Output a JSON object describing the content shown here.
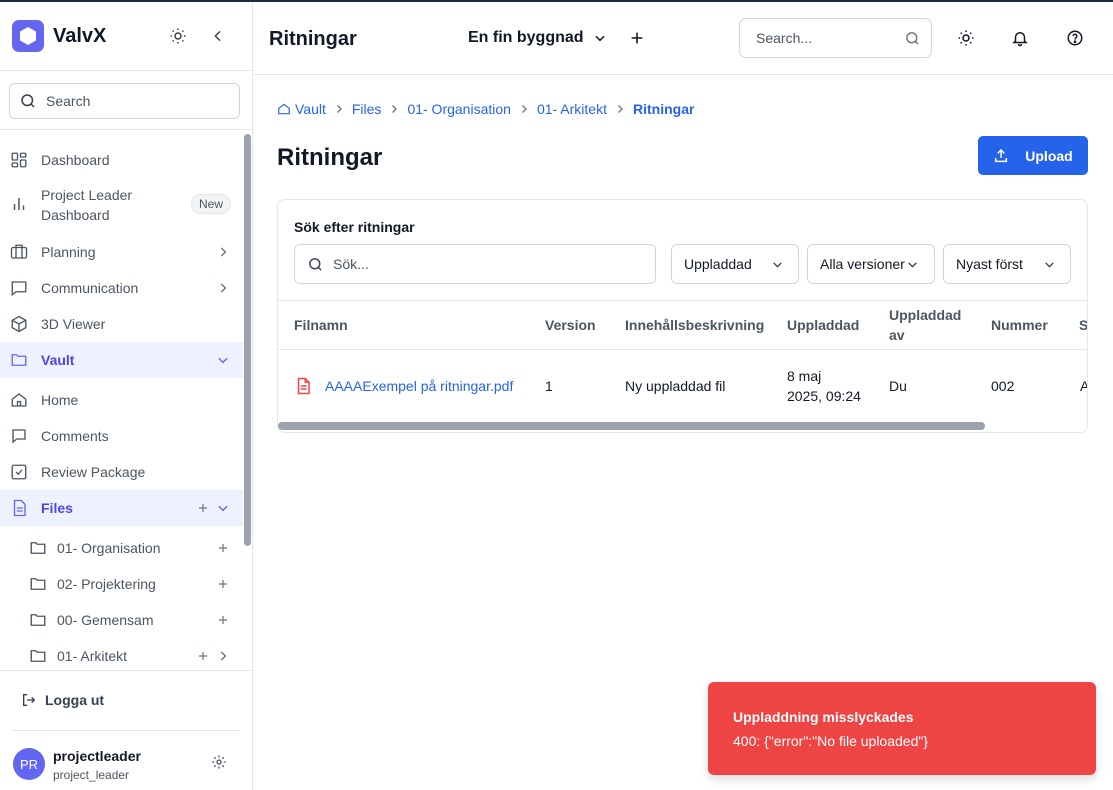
{
  "app": {
    "brand": "ValvX"
  },
  "sidebar": {
    "search_placeholder": "Search",
    "items": [
      {
        "label": "Dashboard",
        "icon": "dashboard-icon"
      },
      {
        "label": "Project Leader Dashboard",
        "label_line1": "Project Leader",
        "label_line2": "Dashboard",
        "badge": "New",
        "icon": "bar-chart-icon"
      },
      {
        "label": "Planning",
        "icon": "planning-icon"
      },
      {
        "label": "Communication",
        "icon": "chat-icon"
      },
      {
        "label": "3D Viewer",
        "icon": "cube-icon"
      },
      {
        "label": "Vault",
        "icon": "folder-icon",
        "active": true
      },
      {
        "label": "Home",
        "icon": "home-icon"
      },
      {
        "label": "Comments",
        "icon": "comment-icon"
      },
      {
        "label": "Review Package",
        "icon": "checkbox-icon"
      },
      {
        "label": "Files",
        "icon": "file-icon",
        "active": true
      }
    ],
    "folders": [
      {
        "label": "01- Organisation"
      },
      {
        "label": "02- Projektering"
      },
      {
        "label": "00- Gemensam"
      },
      {
        "label": "01- Arkitekt"
      }
    ],
    "logout_label": "Logga ut",
    "user": {
      "initials": "PR",
      "name": "projectleader",
      "role": "project_leader"
    }
  },
  "topbar": {
    "title": "Ritningar",
    "project": "En fin byggnad",
    "search_placeholder": "Search..."
  },
  "breadcrumb": [
    "Vault",
    "Files",
    "01- Organisation",
    "01- Arkitekt",
    "Ritningar"
  ],
  "main": {
    "title": "Ritningar",
    "upload_label": "Upload",
    "filter_label": "Sök efter ritningar",
    "filter_placeholder": "Sök...",
    "filters": [
      "Uppladdad",
      "Alla versioner",
      "Nyast först"
    ]
  },
  "table": {
    "columns": [
      "Filnamn",
      "Version",
      "Innehållsbeskrivning",
      "Uppladdad",
      "Uppladdad av",
      "Nummer",
      "S"
    ],
    "columns_wrapped": {
      "uploaded_by_line1": "Uppladdad",
      "uploaded_by_line2": "av"
    },
    "rows": [
      {
        "filename": "AAAAExempel på ritningar.pdf",
        "version": "1",
        "description": "Ny uppladdad fil",
        "uploaded": "8 maj 2025, 09:24",
        "uploaded_line1": "8 maj",
        "uploaded_line2": "2025, 09:24",
        "uploaded_by": "Du",
        "number": "002",
        "status": "A"
      }
    ]
  },
  "toast": {
    "title": "Uppladdning misslyckades",
    "message": "400: {\"error\":\"No file uploaded\"}",
    "color": "#ef4444"
  },
  "colors": {
    "accent": "#6366f1",
    "primary": "#2563eb",
    "error": "#ef4444"
  }
}
